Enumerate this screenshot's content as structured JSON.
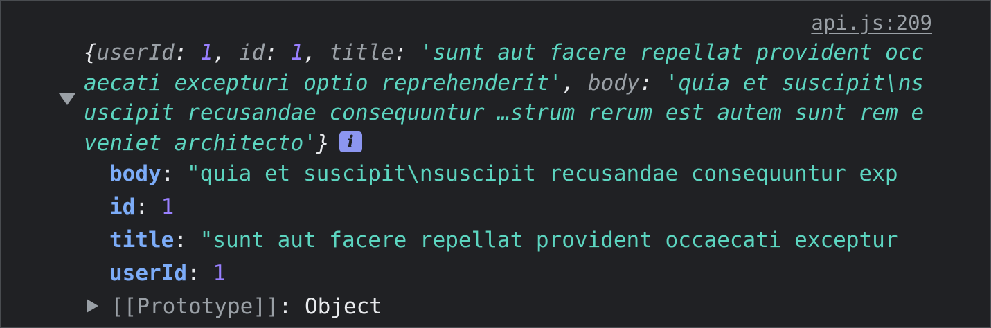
{
  "source_link": "api.js:209",
  "preview": {
    "open_brace": "{",
    "userId_key": "userId",
    "userId_value": "1",
    "id_key": "id",
    "id_value": "1",
    "title_key": "title",
    "title_value": "'sunt aut facere repellat provident occaecati excepturi optio reprehenderit'",
    "body_key": "body",
    "body_value": "'quia et suscipit\\nsuscipit recusandae consequuntur …strum rerum est autem sunt rem eveniet architecto'",
    "close_brace": "}",
    "info_icon_glyph": "i"
  },
  "properties": [
    {
      "key": "body",
      "value": "\"quia et suscipit\\nsuscipit recusandae consequuntur exp",
      "type": "string"
    },
    {
      "key": "id",
      "value": "1",
      "type": "number"
    },
    {
      "key": "title",
      "value": "\"sunt aut facere repellat provident occaecati exceptur",
      "type": "string"
    },
    {
      "key": "userId",
      "value": "1",
      "type": "number"
    }
  ],
  "prototype": {
    "key": "[[Prototype]]",
    "value": "Object"
  },
  "colors": {
    "background": "#202124",
    "key_gray": "#9aa0a6",
    "number_purple": "#9980ff",
    "string_teal": "#5cd5c0",
    "prop_key_blue": "#7cacf8",
    "info_badge": "#8c96f0"
  }
}
